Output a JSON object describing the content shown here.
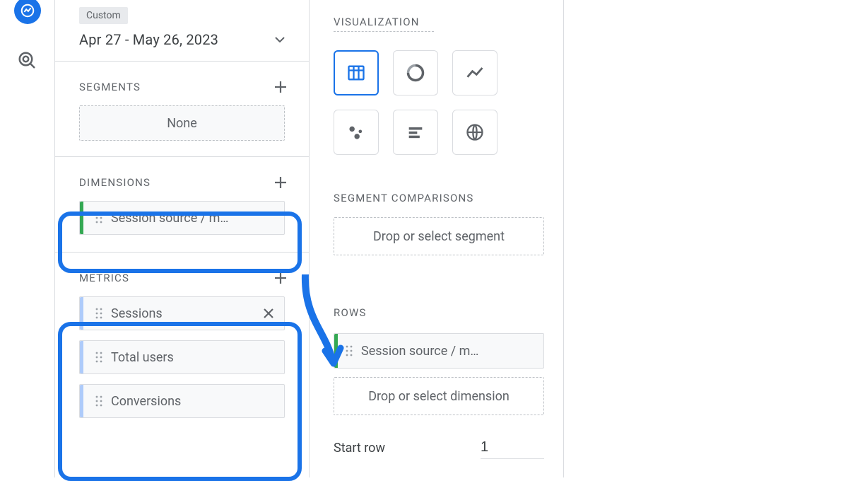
{
  "nav": {
    "chart_icon": "chart-icon",
    "explore_icon": "cursor-click-icon"
  },
  "date": {
    "badge": "Custom",
    "range": "Apr 27 - May 26, 2023"
  },
  "segments": {
    "title": "SEGMENTS",
    "empty": "None"
  },
  "dimensions": {
    "title": "DIMENSIONS",
    "item": "Session source / m…"
  },
  "metrics": {
    "title": "METRICS",
    "items": [
      "Sessions",
      "Total users",
      "Conversions"
    ]
  },
  "visualization": {
    "title": "VISUALIZATION",
    "options": [
      "table",
      "donut",
      "line",
      "scatter",
      "bar",
      "geo"
    ],
    "selected": "table"
  },
  "segment_comparisons": {
    "title": "SEGMENT COMPARISONS",
    "drop": "Drop or select segment"
  },
  "rows": {
    "title": "ROWS",
    "item": "Session source / m…",
    "drop": "Drop or select dimension",
    "start_row_label": "Start row",
    "start_row_value": "1"
  }
}
